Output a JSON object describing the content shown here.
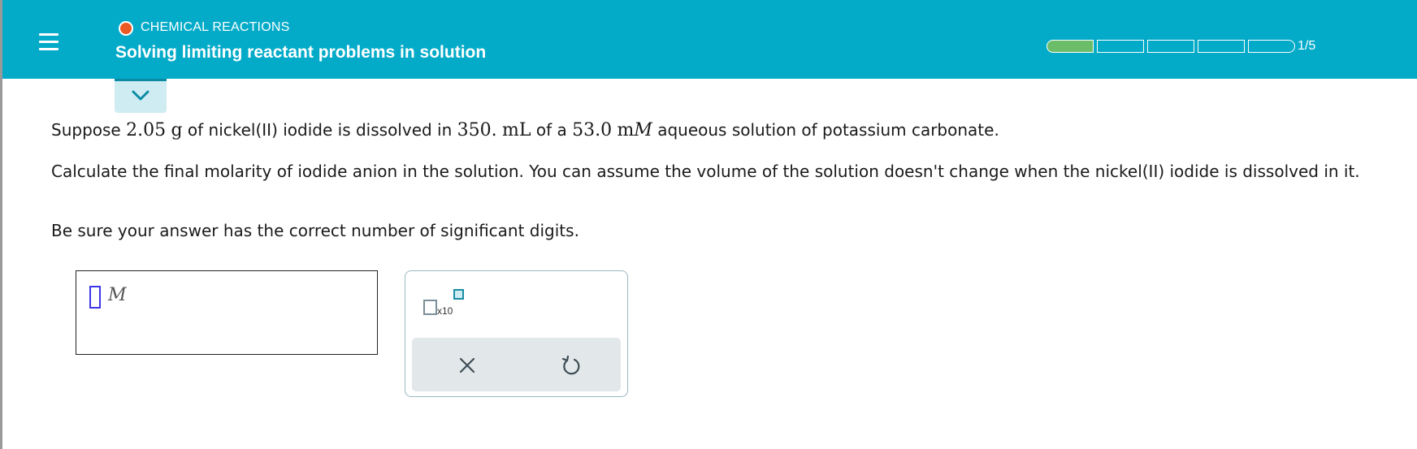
{
  "header": {
    "topic": "CHEMICAL REACTIONS",
    "title": "Solving limiting reactant problems in solution",
    "progress": {
      "completed": 1,
      "total": 5,
      "label": "1/5"
    },
    "accent_color": "#03abc9",
    "topic_dot_color": "#ec5a24",
    "progress_done_color": "#6cbd6a"
  },
  "icons": {
    "menu": "hamburger-menu-icon",
    "collapse": "chevron-down-icon",
    "clear": "close-icon",
    "undo": "undo-icon"
  },
  "question": {
    "p1_prefix": "Suppose",
    "mass_value": "2.05",
    "mass_unit": "g",
    "p1_mid1": "of nickel(II) iodide is dissolved in",
    "volume_value": "350.",
    "volume_unit": "mL",
    "p1_mid2": "of a",
    "conc_value": "53.0",
    "conc_prefix": "m",
    "conc_unit": "M",
    "p1_suffix": "aqueous solution of potassium carbonate.",
    "p2": "Calculate the final molarity of iodide anion in the solution. You can assume the volume of the solution doesn't change when the nickel(II) iodide is dissolved in it.",
    "p3": "Be sure your answer has the correct number of significant digits."
  },
  "answer": {
    "value": "",
    "unit": "M"
  },
  "tools": {
    "sci_notation_label": "x10"
  }
}
